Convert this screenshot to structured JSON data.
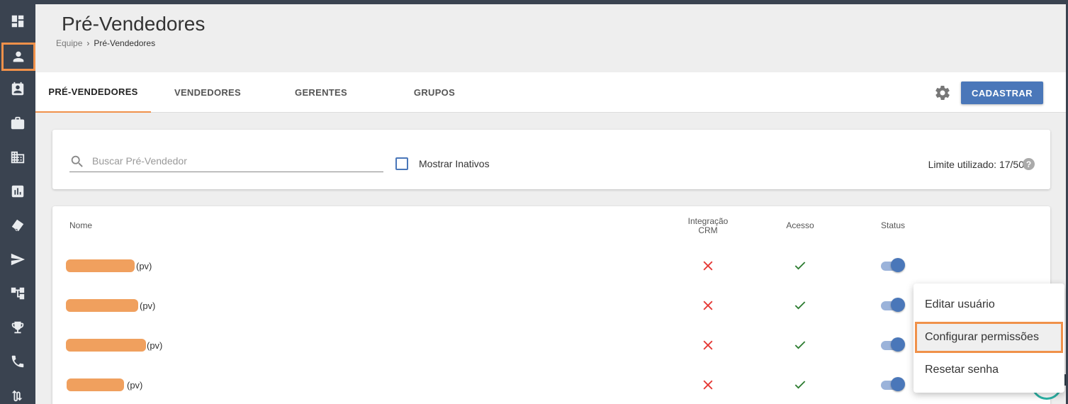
{
  "header": {
    "title": "Pré-Vendedores",
    "breadcrumb": {
      "root": "Equipe",
      "separator": "›",
      "current": "Pré-Vendedores"
    }
  },
  "sidebar": {
    "items": [
      {
        "icon": "dashboard-icon"
      },
      {
        "icon": "person-icon",
        "active": true
      },
      {
        "icon": "contact-card-icon"
      },
      {
        "icon": "briefcase-icon"
      },
      {
        "icon": "building-icon"
      },
      {
        "icon": "bar-chart-icon"
      },
      {
        "icon": "tag-icon"
      },
      {
        "icon": "send-icon"
      },
      {
        "icon": "hierarchy-icon"
      },
      {
        "icon": "trophy-icon"
      },
      {
        "icon": "phone-icon"
      },
      {
        "icon": "route-icon"
      }
    ]
  },
  "tabs": [
    {
      "label": "PRÉ-VENDEDORES",
      "active": true
    },
    {
      "label": "VENDEDORES"
    },
    {
      "label": "GERENTES"
    },
    {
      "label": "GRUPOS"
    }
  ],
  "toolbar": {
    "register_label": "CADASTRAR"
  },
  "filters": {
    "search_placeholder": "Buscar Pré-Vendedor",
    "search_value": "",
    "show_inactive_label": "Mostrar Inativos",
    "show_inactive_checked": false,
    "limit_text": "Limite utilizado: 17/50",
    "help": "?"
  },
  "table": {
    "headers": {
      "name": "Nome",
      "crm_line1": "Integração",
      "crm_line2": "CRM",
      "access": "Acesso",
      "status": "Status"
    },
    "rows": [
      {
        "name_suffix": "(pv)",
        "crm_integration": false,
        "access": true,
        "status_active": true
      },
      {
        "name_suffix": "(pv)",
        "crm_integration": false,
        "access": true,
        "status_active": true
      },
      {
        "name_suffix": "(pv)",
        "crm_integration": false,
        "access": true,
        "status_active": true
      },
      {
        "name_suffix": "(pv)",
        "crm_integration": false,
        "access": true,
        "status_active": true
      }
    ]
  },
  "context_menu": {
    "items": [
      {
        "label": "Editar usuário"
      },
      {
        "label": "Configurar permissões",
        "highlighted": true
      },
      {
        "label": "Resetar senha"
      }
    ]
  },
  "colors": {
    "sidebar_bg": "#3a4350",
    "accent_orange": "#f0914a",
    "primary_blue": "#4a77b9",
    "error_red": "#e53935",
    "success_green": "#2e7d32"
  }
}
